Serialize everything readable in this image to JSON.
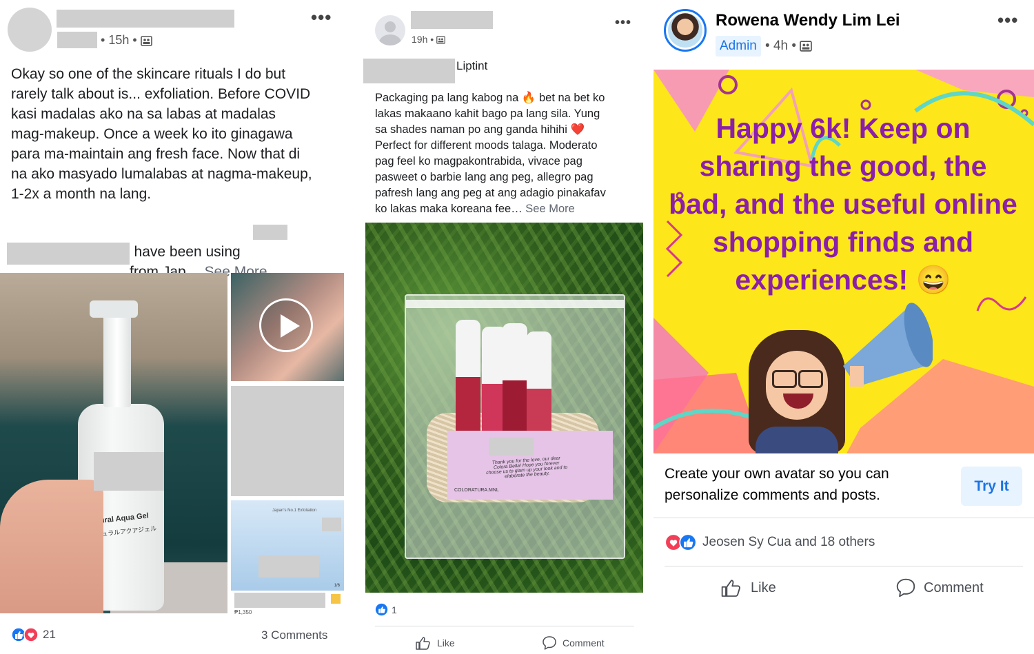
{
  "post1": {
    "time": "15h",
    "body": "Okay so one of the skincare rituals I do but\nrarely talk about is... exfoliation. Before COVID\nkasi madalas ako na sa labas at madalas\nmag-makeup. Once a week ko ito ginagawa\npara ma-maintain ang fresh face. Now that di\nna ako masyado lumalabas at nagma-makeup,\n1-2x a month na lang.",
    "body2a": "Anyway for years I have been using",
    "body2b": "from Jap…",
    "see_more": "See More",
    "product_label": "Natural Aqua Gel",
    "product_label_jp": "ナチュラルアクアジェル",
    "thumb_caption": "Japan's No.1 Exfoliation",
    "thumb_page": "1/6",
    "price": "₱1,350",
    "reactions_count": "21",
    "comments": "3 Comments"
  },
  "post2": {
    "time": "19h",
    "title_suffix": "Liptint",
    "body": "Packaging pa lang kabog na 🔥 bet na bet ko\nlakas makaano kahit bago pa lang sila. Yung\nsa shades naman po ang ganda hihihi ❤️\nPerfect for different moods talaga. Moderato\npag feel ko magpakontrabida, vivace pag\npasweet o barbie lang ang peg, allegro pag\npafresh lang ang peg at ang adagio  pinakafav\nko lakas maka koreana fee…",
    "see_more": "See More",
    "card_text": "Thank you for the love, our dear Colora Bella! Hope you forever choose us to glam up your look and to elaborate the beauty.",
    "card_handle": "COLORATURA.MNL",
    "reactions_count": "1",
    "like": "Like",
    "comment": "Comment"
  },
  "post3": {
    "author": "Rowena Wendy Lim Lei",
    "badge": "Admin",
    "time": "4h",
    "banner_text": "Happy 6k! Keep on sharing the good, the bad, and the useful online shopping finds and experiences! 😄",
    "promo_text": "Create your own avatar so you can personalize comments and posts.",
    "try_button": "Try It",
    "reactions_text": "Jeosen Sy Cua and 18 others",
    "like": "Like",
    "comment": "Comment"
  },
  "colors": {
    "fb_blue": "#1877f2",
    "reaction_red": "#f33e58",
    "banner_yellow": "#fde619",
    "banner_text": "#8b1fa9",
    "badge_bg": "#e7f3ff",
    "badge_text": "#1b74e4"
  },
  "icons": [
    "more-icon",
    "members-icon",
    "like-reaction-icon",
    "love-reaction-icon",
    "like-icon",
    "comment-icon",
    "play-icon",
    "avatar-icon"
  ]
}
